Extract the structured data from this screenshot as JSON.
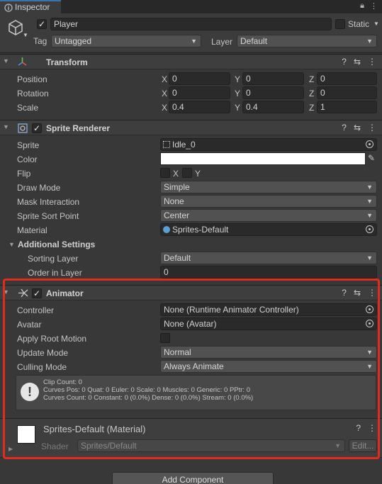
{
  "tab": {
    "title": "Inspector",
    "icons": [
      "lock-icon",
      "more-icon"
    ]
  },
  "header": {
    "object_name": "Player",
    "active": true,
    "static_label": "Static",
    "tag_label": "Tag",
    "tag_value": "Untagged",
    "layer_label": "Layer",
    "layer_value": "Default"
  },
  "transform": {
    "title": "Transform",
    "rows": [
      {
        "label": "Position",
        "x": "0",
        "y": "0",
        "z": "0"
      },
      {
        "label": "Rotation",
        "x": "0",
        "y": "0",
        "z": "0"
      },
      {
        "label": "Scale",
        "x": "0.4",
        "y": "0.4",
        "z": "1"
      }
    ],
    "axis": {
      "x": "X",
      "y": "Y",
      "z": "Z"
    }
  },
  "sprite_renderer": {
    "title": "Sprite Renderer",
    "enabled": true,
    "sprite_label": "Sprite",
    "sprite_value": "Idle_0",
    "color_label": "Color",
    "color_value": "#ffffff",
    "flip_label": "Flip",
    "flip_x": "X",
    "flip_y": "Y",
    "draw_mode_label": "Draw Mode",
    "draw_mode_value": "Simple",
    "mask_label": "Mask Interaction",
    "mask_value": "None",
    "sort_point_label": "Sprite Sort Point",
    "sort_point_value": "Center",
    "material_label": "Material",
    "material_value": "Sprites-Default",
    "additional_label": "Additional Settings",
    "sorting_layer_label": "Sorting Layer",
    "sorting_layer_value": "Default",
    "order_label": "Order in Layer",
    "order_value": "0"
  },
  "animator": {
    "title": "Animator",
    "enabled": true,
    "controller_label": "Controller",
    "controller_value": "None (Runtime Animator Controller)",
    "avatar_label": "Avatar",
    "avatar_value": "None (Avatar)",
    "root_motion_label": "Apply Root Motion",
    "root_motion_value": false,
    "update_mode_label": "Update Mode",
    "update_mode_value": "Normal",
    "culling_label": "Culling Mode",
    "culling_value": "Always Animate",
    "info_line1": "Clip Count: 0",
    "info_line2": "Curves Pos: 0 Quat: 0 Euler: 0 Scale: 0 Muscles: 0 Generic: 0 PPtr: 0",
    "info_line3": "Curves Count: 0 Constant: 0 (0.0%) Dense: 0 (0.0%) Stream: 0 (0.0%)"
  },
  "material": {
    "title": "Sprites-Default (Material)",
    "shader_label": "Shader",
    "shader_value": "Sprites/Default",
    "edit_label": "Edit..."
  },
  "add_component_label": "Add Component",
  "colors": {
    "highlight": "#e02b1e",
    "accent": "#3a72b0"
  }
}
